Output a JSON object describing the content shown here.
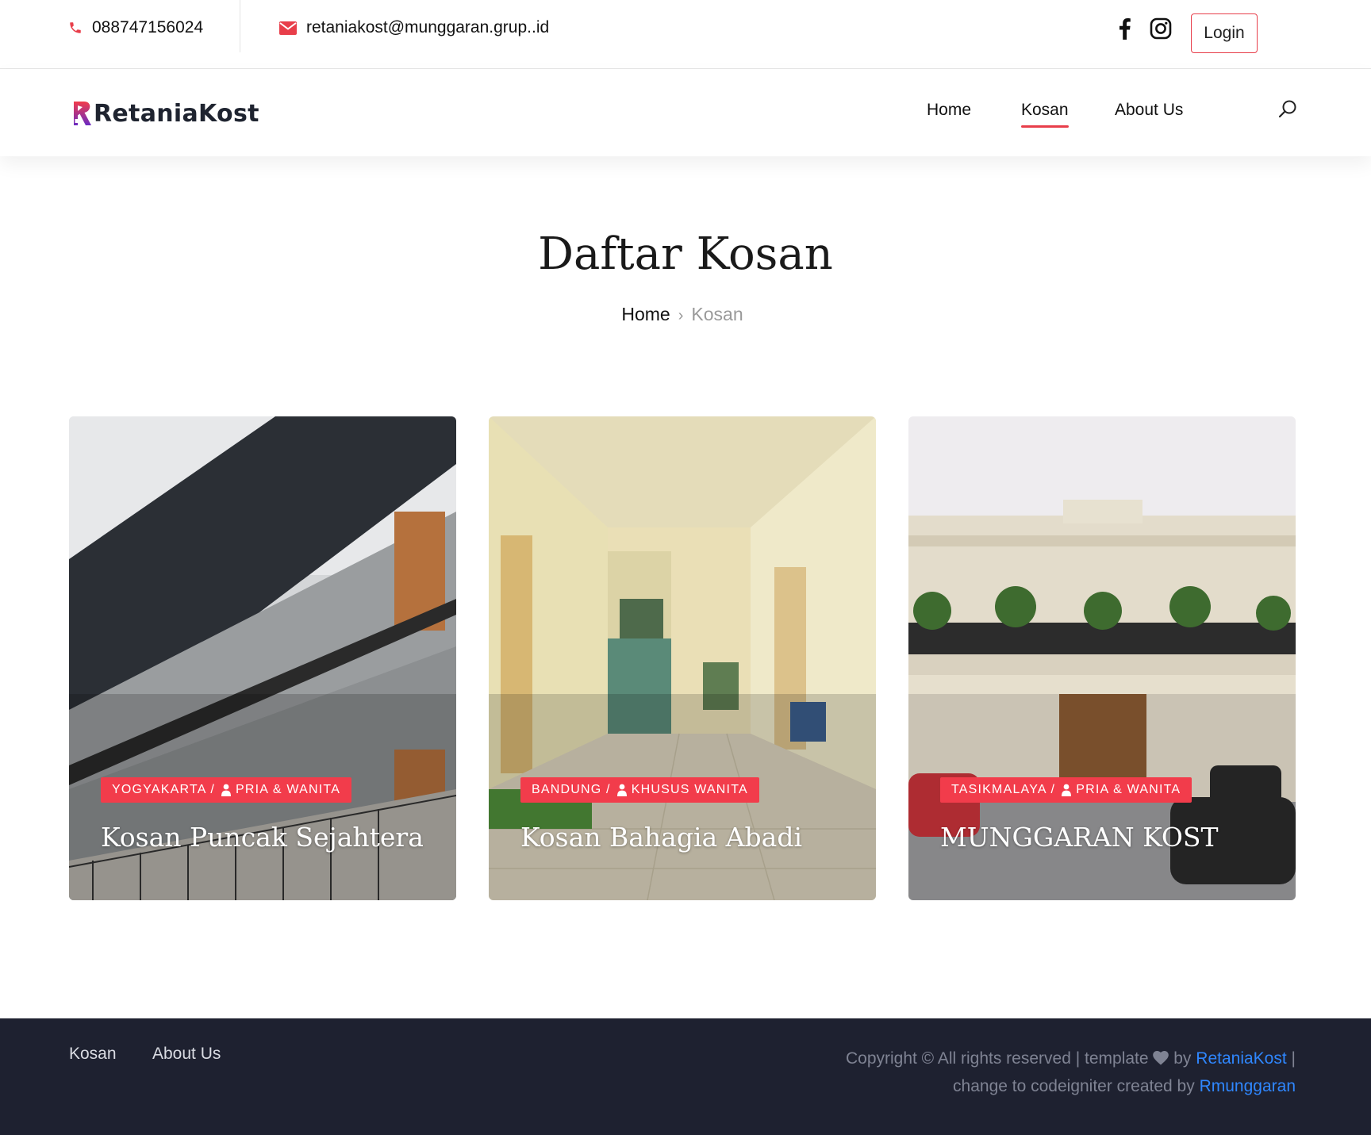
{
  "topbar": {
    "phone": "088747156024",
    "email": "retaniakost@munggaran.grup..id",
    "login_label": "Login"
  },
  "navbar": {
    "logo_text": "RetaniaKost",
    "links": [
      {
        "label": "Home"
      },
      {
        "label": "Kosan",
        "active": true
      },
      {
        "label": "About Us"
      }
    ]
  },
  "header": {
    "title": "Daftar Kosan",
    "breadcrumb": {
      "home": "Home",
      "current": "Kosan"
    }
  },
  "cards": [
    {
      "city": "YOGYAKARTA /",
      "gender": "PRIA & WANITA",
      "name": "Kosan Puncak Sejahtera"
    },
    {
      "city": "BANDUNG /",
      "gender": "KHUSUS WANITA",
      "name": "Kosan Bahagia Abadi"
    },
    {
      "city": "TASIKMALAYA /",
      "gender": "PRIA & WANITA",
      "name": "MUNGGARAN KOST"
    }
  ],
  "footer": {
    "links": [
      {
        "label": "Kosan"
      },
      {
        "label": "About Us"
      }
    ],
    "copyright_prefix": "Copyright © All rights reserved | template",
    "by": "by",
    "brand": "RetaniaKost",
    "pipe": "|",
    "line2_prefix": "change to codeigniter created by",
    "author": "Rmunggaran"
  },
  "colors": {
    "accent": "#f23c4b",
    "footer_bg": "#1e2130",
    "link_blue": "#2f87ff"
  }
}
